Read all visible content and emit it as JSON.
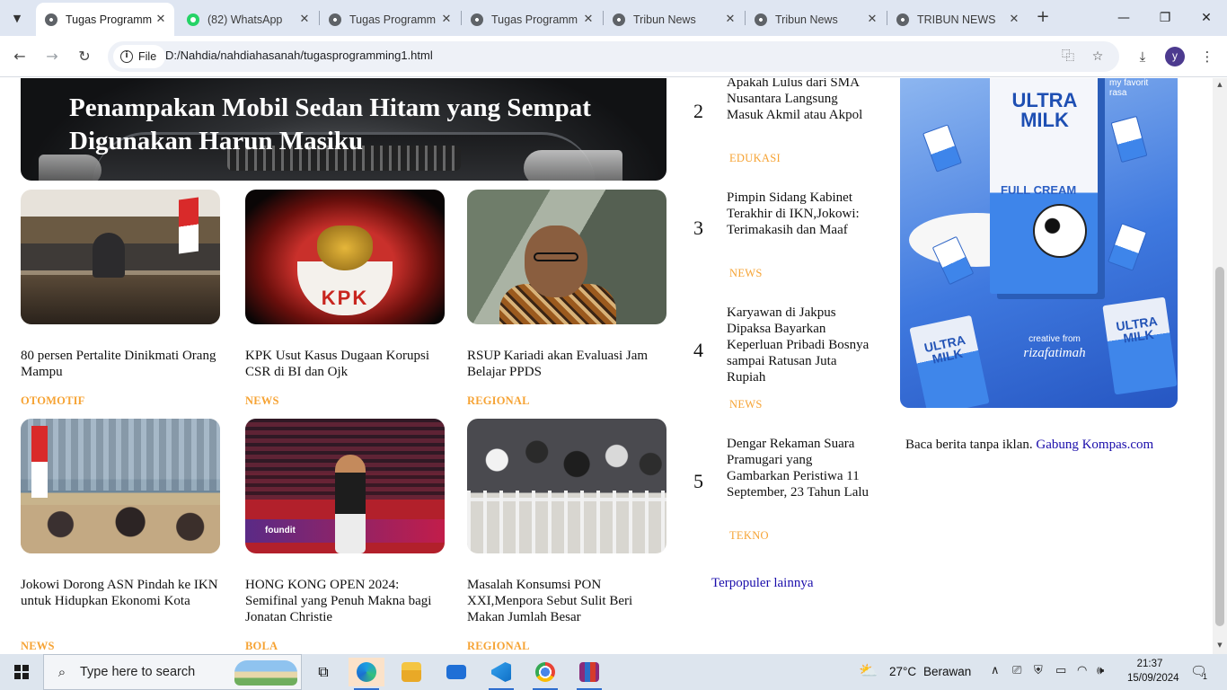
{
  "browser": {
    "tabs": [
      {
        "title": "Tugas Programm",
        "favicon": "globe-icon",
        "active": true
      },
      {
        "title": "(82) WhatsApp",
        "favicon": "whatsapp-icon",
        "active": false
      },
      {
        "title": "Tugas Programm",
        "favicon": "globe-icon",
        "active": false
      },
      {
        "title": "Tugas Programm",
        "favicon": "globe-icon",
        "active": false
      },
      {
        "title": "Tribun News",
        "favicon": "globe-icon",
        "active": false
      },
      {
        "title": "Tribun News",
        "favicon": "globe-icon",
        "active": false
      },
      {
        "title": "TRIBUN NEWS",
        "favicon": "globe-icon",
        "active": false
      }
    ],
    "site_chip": "File",
    "url": "D:/Nahdia/nahdiahasanah/tugasprogramming1.html",
    "profile_initial": "y"
  },
  "hero": {
    "title": "Penampakan Mobil Sedan Hitam yang Sempat Digunakan Harun Masiku"
  },
  "articles": [
    {
      "headline": "80 persen Pertalite Dinikmati Orang Mampu",
      "category": "OTOMOTIF"
    },
    {
      "headline": "KPK Usut Kasus Dugaan Korupsi CSR di BI dan Ojk",
      "category": "NEWS"
    },
    {
      "headline": "RSUP Kariadi akan Evaluasi Jam Belajar PPDS",
      "category": "REGIONAL"
    },
    {
      "headline": "Jokowi Dorong ASN Pindah ke IKN untuk Hidupkan Ekonomi Kota",
      "category": "NEWS"
    },
    {
      "headline": "HONG KONG OPEN 2024: Semifinal yang Penuh Makna bagi Jonatan Christie",
      "category": "BOLA"
    },
    {
      "headline": "Masalah Konsumsi PON XXI,Menpora Sebut Sulit Beri Makan Jumlah Besar",
      "category": "REGIONAL"
    }
  ],
  "thumb_text": {
    "kpk_logo": "KPK",
    "badminton_board": "foundit"
  },
  "popular": {
    "items": [
      {
        "number": "2",
        "title": "Apakah Lulus dari SMA Nusantara Langsung Masuk Akmil atau Akpol",
        "category": "EDUKASI"
      },
      {
        "number": "3",
        "title": "Pimpin Sidang Kabinet Terakhir di IKN,Jokowi: Terimakasih dan Maaf",
        "category": "NEWS"
      },
      {
        "number": "4",
        "title": "Karyawan di Jakpus Dipaksa Bayarkan Keperluan Pribadi Bosnya sampai Ratusan Juta Rupiah",
        "category": "NEWS"
      },
      {
        "number": "5",
        "title": "Dengar Rekaman Suara Pramugari yang Gambarkan Peristiwa 11 September, 23 Tahun Lalu",
        "category": "TEKNO"
      }
    ],
    "more_link": "Terpopuler lainnya"
  },
  "ad": {
    "tagline": "my favorit rasa",
    "brand": "ULTRA MILK",
    "variant": "FULL CREAM",
    "credit": "creative from",
    "signature": "rizafatimah"
  },
  "ad_note": {
    "text": "Baca berita tanpa iklan.",
    "link": "Gabung Kompas.com"
  },
  "taskbar": {
    "search_placeholder": "Type here to search",
    "weather_temp": "27°C",
    "weather_desc": "Berawan",
    "time": "21:37",
    "date": "15/09/2024",
    "notification_count": "1"
  },
  "colors": {
    "category": "#f6a334",
    "link": "#1a0dab",
    "tabstrip": "#dfe6f2",
    "taskbar": "#dde5ee"
  }
}
